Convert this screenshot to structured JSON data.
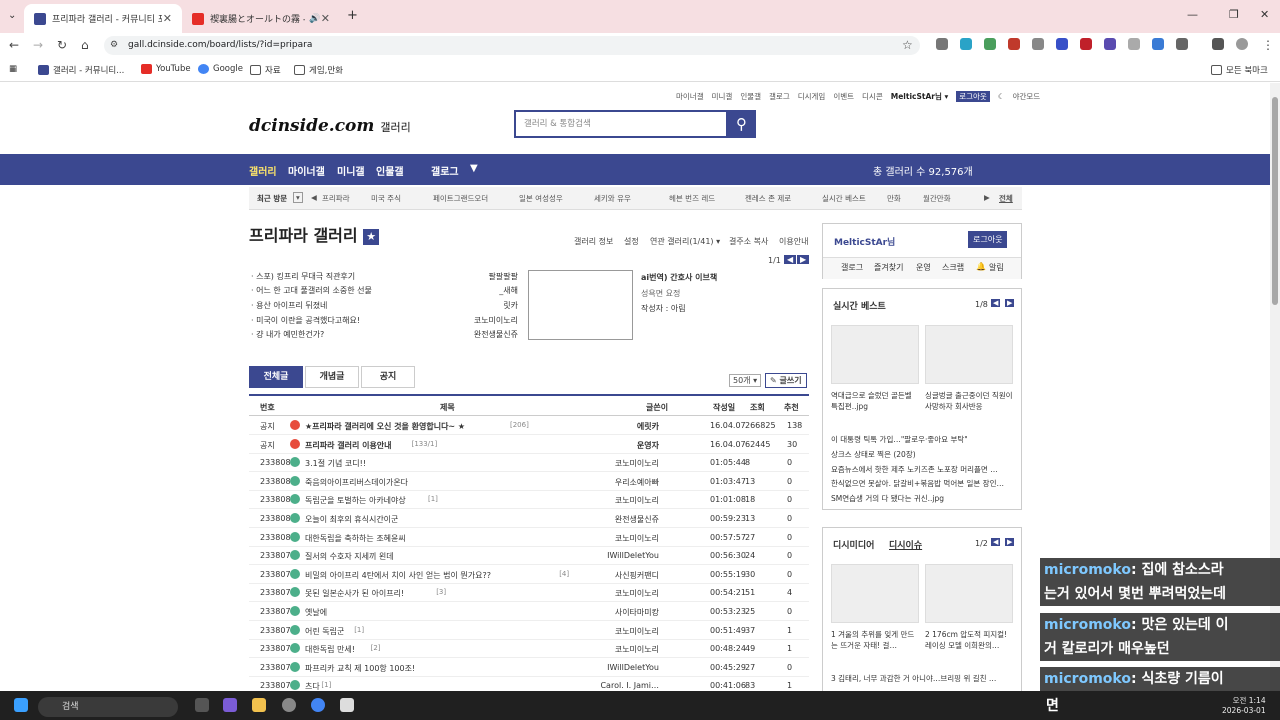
{
  "browser": {
    "tabs": [
      {
        "title": "프리파라 갤러리 - 커뮤니티 포",
        "active": true
      },
      {
        "title": "禊裏腸とオールトの霧 - YouT",
        "active": false
      }
    ],
    "url": "gall.dcinside.com/board/lists/?id=pripara",
    "bookmarks": [
      "갤러리 - 커뮤니티...",
      "YouTube",
      "Google",
      "자료",
      "게임,만화"
    ],
    "all_bookmarks": "모든 북마크"
  },
  "page": {
    "top_links": [
      "마이너갤",
      "미니갤",
      "인물갤",
      "갤로그",
      "디시게임",
      "이벤트",
      "디시콘",
      "MelticStAr님 ▾",
      "로그아웃",
      "야간모드"
    ],
    "logo": "dcinside.com",
    "logo_sub": "갤러리",
    "search_placeholder": "갤러리 & 통합검색",
    "gnb": [
      "갤러리",
      "마이너갤",
      "미니갤",
      "인물갤",
      "갤로그"
    ],
    "gallery_count": "총 갤러리 수 92,576개",
    "recent_label": "최근 방문",
    "recent": [
      "프리파라",
      "미국 주식",
      "페이트그랜드오더",
      "일본 여성성우",
      "세키와 유우",
      "헤븐 번즈 레드",
      "젠레스 존 제로",
      "실시간 베스트",
      "만화",
      "월간만화"
    ],
    "recent_all": "전체",
    "gallery_title": "프리파라 갤러리",
    "gallery_menu": [
      "갤러리 정보",
      "설정",
      "연관 갤러리(1/41) ▾",
      "결주소 복사",
      "이용안내"
    ],
    "page_indicator": "1/1",
    "notices": [
      {
        "text": "· 스포) 킹프리 무대극 직관후기",
        "author": "팔팔팔팔"
      },
      {
        "text": "· 어느 한 고대 풀갤러의 소중한 선물",
        "author": "_새해"
      },
      {
        "text": "· 용산 아이프리 뒤졌네",
        "author": "릿카"
      },
      {
        "text": "· 미국이 이란을 공격했다고해요!",
        "author": "코노미이노리"
      },
      {
        "text": "· 걍 내가 예민한건가?",
        "author": "완전생물신쥬"
      }
    ],
    "ad": {
      "title": "ai번역) 간호사 이브책",
      "line2": "성욕면 요정",
      "author": "작성자 : 아림"
    },
    "list_tabs": [
      "전체글",
      "개념글",
      "공지"
    ],
    "per_page": "50개 ▾",
    "write": "✎ 글쓰기",
    "headers": [
      "번호",
      "제목",
      "글쓴이",
      "작성일",
      "조회",
      "추천"
    ],
    "rows": [
      {
        "no": "공지",
        "title": "★프리파라 갤러리에 오신 것을 환영합니다~ ★",
        "cmt": "[206]",
        "writer": "에릿카",
        "date": "16.04.07",
        "view": "266825",
        "rec": "138",
        "notice": true
      },
      {
        "no": "공지",
        "title": "프리파라 갤러리 이용안내",
        "cmt": "[133/1]",
        "writer": "운영자",
        "date": "16.04.07",
        "view": "62445",
        "rec": "30",
        "notice": true
      },
      {
        "no": "2338084",
        "title": "3.1절 기념 코디!!",
        "cmt": "",
        "writer": "코노미이노리",
        "date": "01:05:44",
        "view": "8",
        "rec": "0"
      },
      {
        "no": "2338083",
        "title": "죽음의아이프리버스데이가온다",
        "cmt": "",
        "writer": "우리소예아빠",
        "date": "01:03:47",
        "view": "13",
        "rec": "0"
      },
      {
        "no": "2338082",
        "title": "독립군을 토벌하는 아카네야상",
        "cmt": "[1]",
        "writer": "코노미이노리",
        "date": "01:01:08",
        "view": "18",
        "rec": "0"
      },
      {
        "no": "2338081",
        "title": "오늘이 최후의 휴식시간이군",
        "cmt": "",
        "writer": "완전생물신쥬",
        "date": "00:59:23",
        "view": "13",
        "rec": "0"
      },
      {
        "no": "2338080",
        "title": "대한독립을 축하하는 조혜윤씨",
        "cmt": "",
        "writer": "코노미이노리",
        "date": "00:57:57",
        "view": "27",
        "rec": "0"
      },
      {
        "no": "2338079",
        "title": "질서의 수호자 지세끼 왼데",
        "cmt": "",
        "writer": "IWillDeletYou",
        "date": "00:56:30",
        "view": "24",
        "rec": "0"
      },
      {
        "no": "2338078",
        "title": "비밀의 아이프리 4탄에서 치이 사인 얻는 법이 뭔가요??",
        "cmt": "[4]",
        "writer": "사신핑커팬디",
        "date": "00:55:19",
        "view": "30",
        "rec": "0"
      },
      {
        "no": "2338077",
        "title": "못된 일본순사가 된 아이프리!",
        "cmt": "[3]",
        "writer": "코노미이노리",
        "date": "00:54:21",
        "view": "51",
        "rec": "4"
      },
      {
        "no": "2338076",
        "title": "옛날에",
        "cmt": "",
        "writer": "사이타마미캉",
        "date": "00:53:23",
        "view": "25",
        "rec": "0"
      },
      {
        "no": "2338075",
        "title": "어린 독립군",
        "cmt": "[1]",
        "writer": "코노미이노리",
        "date": "00:51:49",
        "view": "37",
        "rec": "1"
      },
      {
        "no": "2338073",
        "title": "대한독립 만세!",
        "cmt": "[2]",
        "writer": "코노미이노리",
        "date": "00:48:24",
        "view": "49",
        "rec": "1"
      },
      {
        "no": "2338071",
        "title": "파프리카 교칙 제 100항 100조!",
        "cmt": "",
        "writer": "IWillDeletYou",
        "date": "00:45:29",
        "view": "27",
        "rec": "0"
      },
      {
        "no": "2338070",
        "title": "츠다",
        "cmt": "[1]",
        "writer": "Carol. I. Jami…",
        "date": "00:41:06",
        "view": "83",
        "rec": "1"
      }
    ],
    "side": {
      "user": "MelticStAr님",
      "logout": "로그아웃",
      "user_menu": [
        "갤로그",
        "즐겨찾기",
        "운영",
        "스크랩",
        "알림"
      ],
      "best_title": "실시간 베스트",
      "best_page": "1/8",
      "best_caps": [
        "역대급으로 슬렀던 골든벨 특집편..jpg",
        "싱글벙글 출근중이던 직원이 사망하자 회사반응"
      ],
      "best_list": [
        "이 대통령 틱톡 가입…\"팔로우·좋아요 부탁\"",
        "상크스 상태로 찍은 (20장)",
        "요즘뉴스에서 핫한 제주 노키즈존 노포장 머리플면 …",
        "한식없으면 못살아. 닭갈비+볶음밥 먹어본 일본 장인…",
        "SM연습생 거의 다 됐다는 귀신..jpg"
      ],
      "media_title": "디시미디어",
      "media_title2": "디시이슈",
      "media_page": "1/2",
      "media_caps": [
        "1 겨울의 추위를 잊게 만드는 뜨거운 자태! 걸…",
        "2 176cm 압도적 피지컬! 레이싱 모델 이희완의…"
      ],
      "media_line3": "3 김태리, 너무 과감한 거 아니야…브리핑 위 길친 …"
    }
  },
  "chat": [
    {
      "user": "micromoko",
      "msg": ": 집에 참소스라"
    },
    {
      "user": "",
      "msg": "는거 있어서 몇번 뿌려먹었는데"
    },
    {
      "user": "micromoko",
      "msg": ": 맛은 있는데 이"
    },
    {
      "user": "",
      "msg": "거 칼로리가 매우높던"
    },
    {
      "user": "micromoko",
      "msg": ": 식초량 기름이"
    }
  ],
  "taskbar": {
    "search": "검색",
    "time": "오전 1:14",
    "date": "2026-03-01",
    "ime": "면"
  }
}
